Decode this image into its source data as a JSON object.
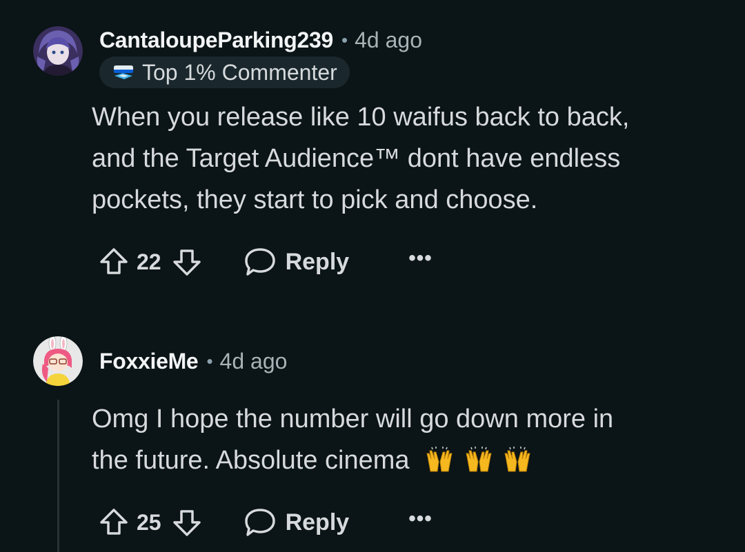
{
  "comments": [
    {
      "username": "CantaloupeParking239",
      "separator": "•",
      "time": "4d ago",
      "badge": {
        "icon": "top-commenter-icon",
        "label": "Top 1% Commenter"
      },
      "lines": [
        "When you release like 10 waifus back to back,",
        "and the Target Audience™ dont have endless",
        "pockets, they start to pick and choose."
      ],
      "score": "22",
      "reply_label": "Reply",
      "more_label": "•••"
    },
    {
      "username": "FoxxieMe",
      "separator": "•",
      "time": "4d ago",
      "lines": [
        "Omg I hope the number will go down more in",
        "the future. Absolute cinema"
      ],
      "emojis": [
        "🙌",
        "🙌",
        "🙌"
      ],
      "score": "25",
      "reply_label": "Reply",
      "more_label": "•••"
    }
  ],
  "colors": {
    "background": "#0b1416",
    "text": "#d7dadc",
    "muted": "#a8b3b8",
    "badge_bg": "#1a282d",
    "thread_line": "#2a3236"
  }
}
